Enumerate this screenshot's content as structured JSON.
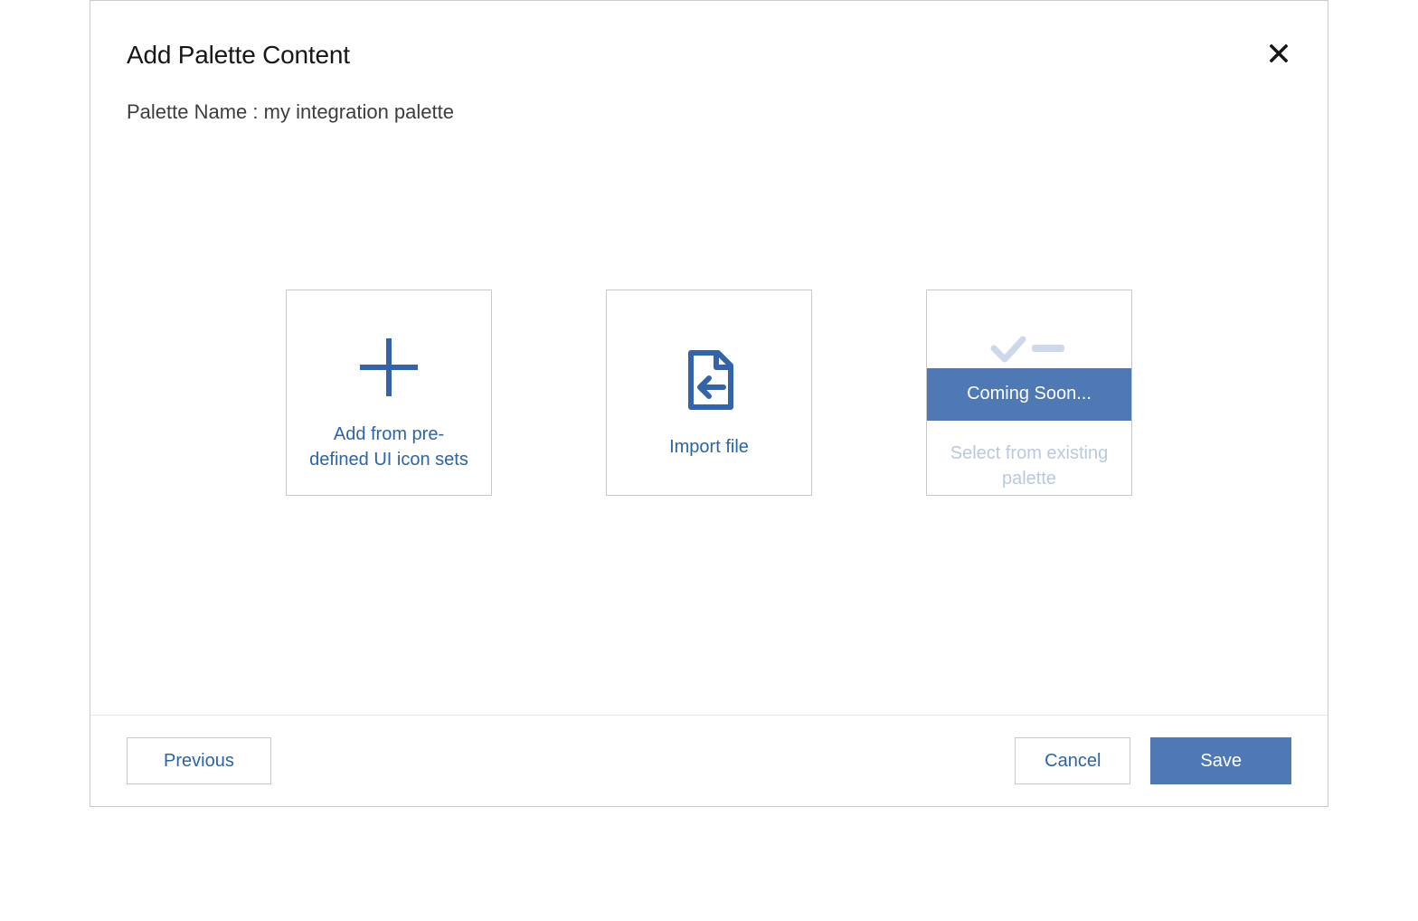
{
  "dialog": {
    "title": "Add Palette Content",
    "palette_name_label": "Palette Name : ",
    "palette_name_value": "my integration palette"
  },
  "cards": {
    "predefined": {
      "label": "Add from pre-defined UI icon sets",
      "icon": "plus-icon"
    },
    "import": {
      "label": "Import file",
      "icon": "file-import-icon"
    },
    "existing": {
      "label": "Select from existing palette",
      "icon": "checklist-icon",
      "banner": "Coming Soon..."
    }
  },
  "footer": {
    "previous": "Previous",
    "cancel": "Cancel",
    "save": "Save"
  },
  "colors": {
    "primary_blue": "#4e79b5",
    "link_blue": "#2c64a6",
    "icon_blue": "#3563a7",
    "disabled_icon": "#cdd9ea"
  }
}
